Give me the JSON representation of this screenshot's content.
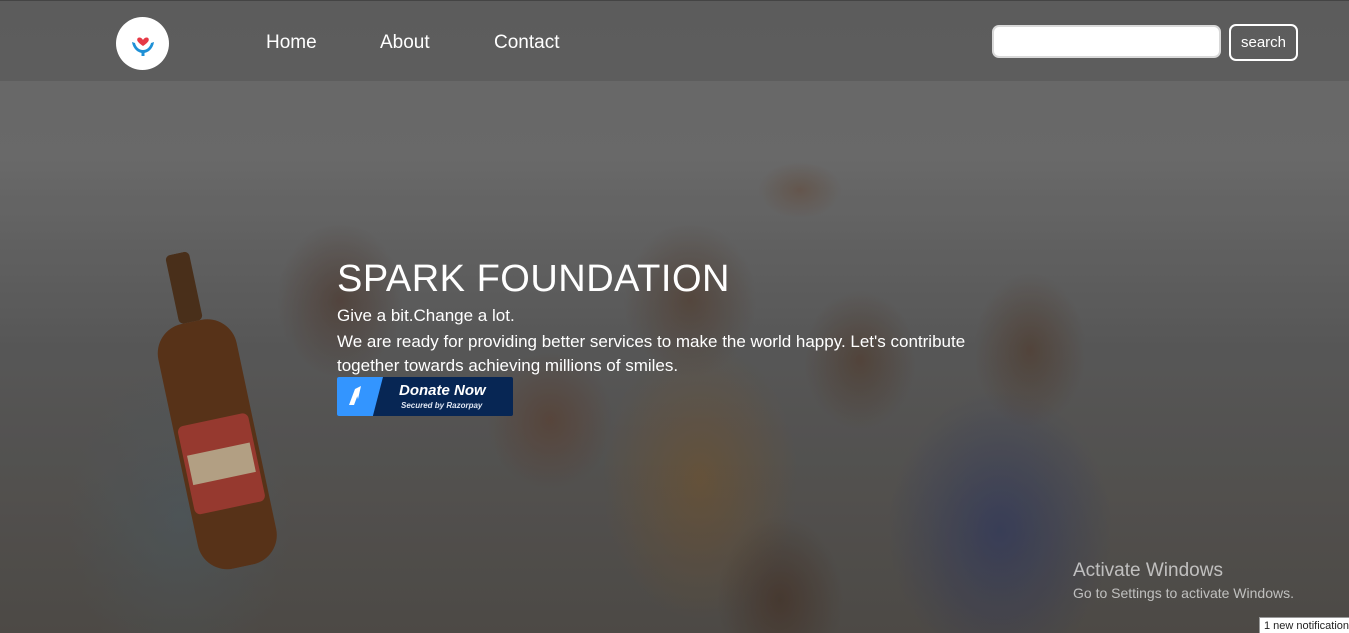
{
  "nav": {
    "links": [
      "Home",
      "About",
      "Contact"
    ],
    "search": {
      "value": "",
      "placeholder": "",
      "button_label": "search"
    },
    "logo_icon": "hands-heart-icon"
  },
  "hero": {
    "title": "SPARK FOUNDATION",
    "tagline": "Give a bit.Change a lot.",
    "description": "We are ready for providing better services to make the world happy. Let's contribute together towards achieving millions of smiles.",
    "donate": {
      "label": "Donate Now",
      "sublabel": "Secured by Razorpay"
    }
  },
  "windows_watermark": {
    "title": "Activate Windows",
    "subtitle": "Go to Settings to activate Windows."
  },
  "notification": {
    "text": "1 new notification"
  },
  "colors": {
    "nav_bg": "#5a5a5a",
    "donate_bg": "#072654",
    "donate_accent": "#3395ff",
    "text": "#ffffff",
    "logo_red": "#e63946",
    "logo_blue": "#1e90d6"
  }
}
